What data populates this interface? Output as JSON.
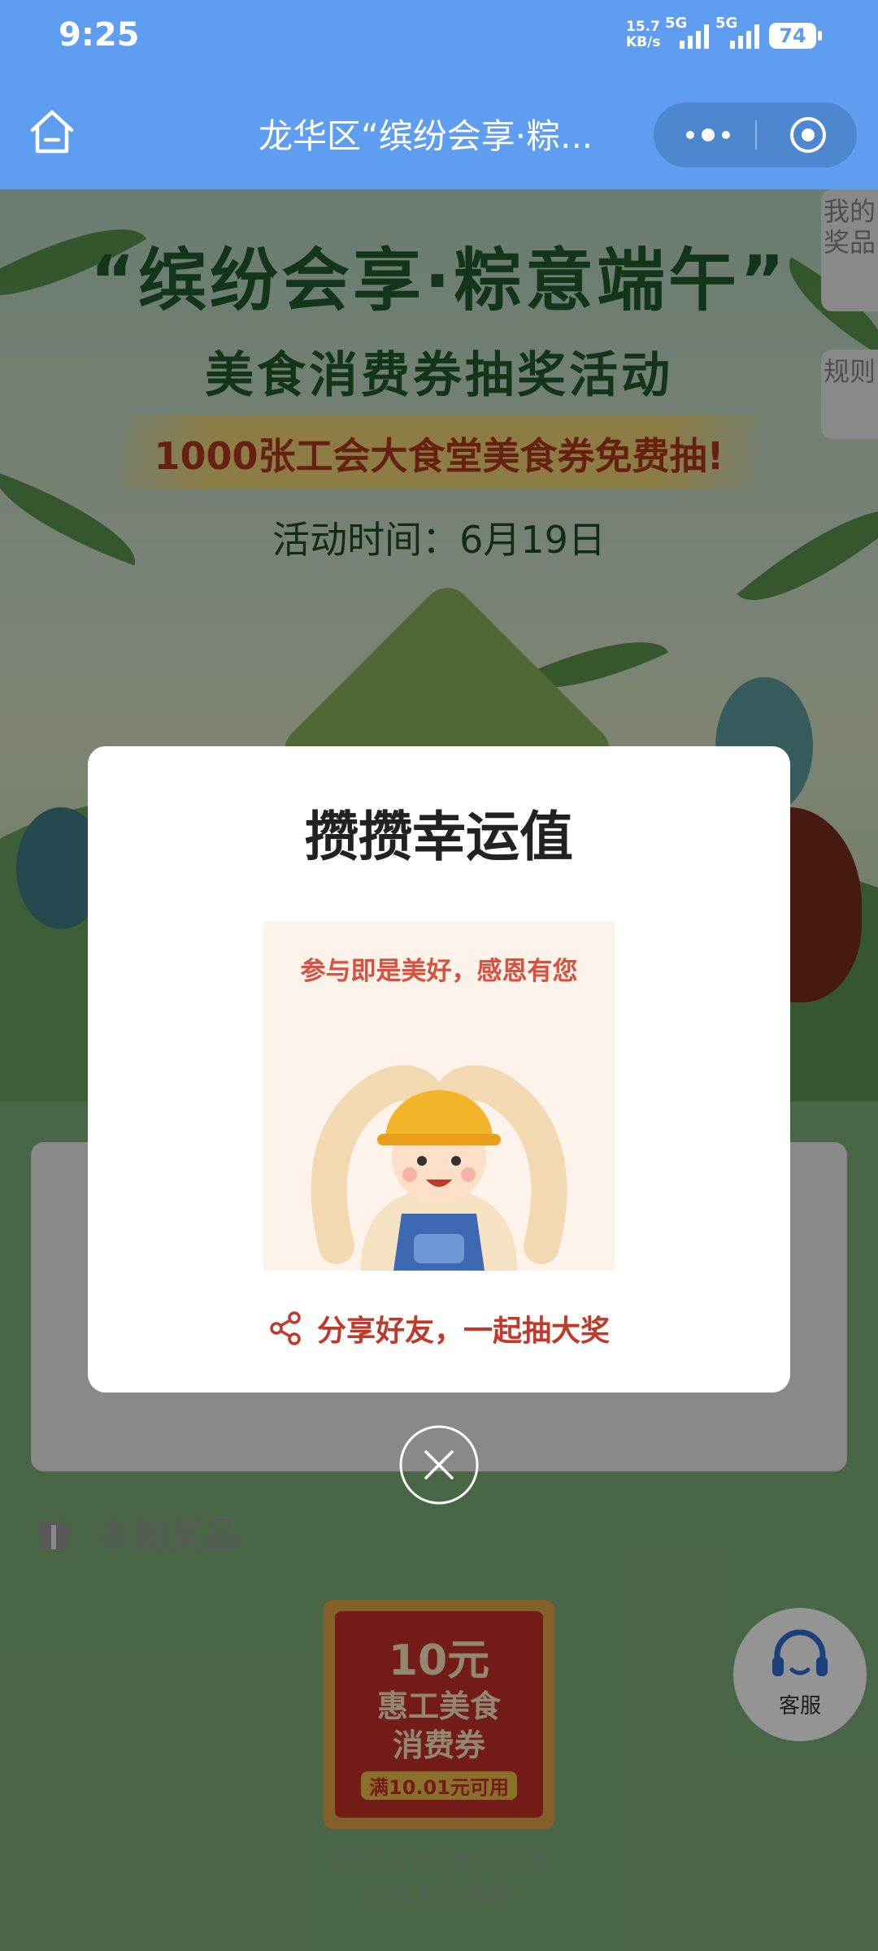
{
  "status_bar": {
    "time": "9:25",
    "net_speed_value": "15.7",
    "net_speed_unit": "KB/s",
    "sim1": "5G",
    "sim2": "5G",
    "battery": "74"
  },
  "nav": {
    "title": "龙华区“缤纷会享·粽..."
  },
  "banner": {
    "title_line1": "“缤纷会享·粽意端午”",
    "title_line2": "美食消费券抽奖活动",
    "ribbon": "1000张工会大食堂美食券免费抽!",
    "activity_time": "活动时间：6月19日"
  },
  "side_tabs": {
    "my_prizes": "我的奖品",
    "rules": "规则"
  },
  "modal": {
    "title": "攒攒幸运值",
    "poster_text": "参与即是美好，感恩有您",
    "share_label": "分享好友，一起抽大奖"
  },
  "prizes": {
    "header": "本期奖品",
    "coupon_amount": "10元",
    "coupon_line1": "惠工美食",
    "coupon_line2": "消费券",
    "coupon_condition": "满10.01元可用",
    "description": "满10.01元减10元惠工美食消费券"
  },
  "service": {
    "label": "客服"
  },
  "colors": {
    "nav_blue": "#5f9df0",
    "accent_red": "#c0392b",
    "banner_green": "#225c2b"
  }
}
